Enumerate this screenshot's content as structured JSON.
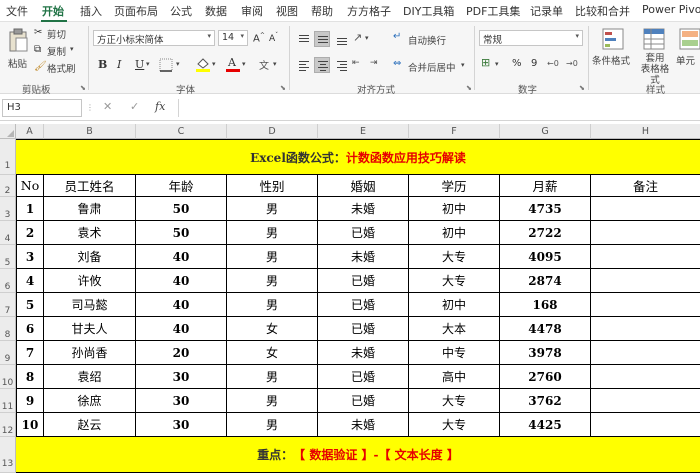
{
  "menu": {
    "items": [
      "文件",
      "开始",
      "插入",
      "页面布局",
      "公式",
      "数据",
      "审阅",
      "视图",
      "帮助",
      "方方格子",
      "DIY工具箱",
      "PDF工具集",
      "记录单",
      "比较和合并",
      "Power Pivot"
    ]
  },
  "ribbon": {
    "clipboard": {
      "paste": "粘贴",
      "cut": "剪切",
      "copy": "复制",
      "format_painter": "格式刷",
      "label": "剪贴板"
    },
    "font": {
      "family": "方正小标宋简体",
      "size": "14",
      "bold": "B",
      "italic": "I",
      "underline": "U",
      "label": "字体"
    },
    "alignment": {
      "wrap": "自动换行",
      "merge": "合并后居中",
      "label": "对齐方式"
    },
    "number": {
      "format": "常规",
      "percent": "%",
      "comma": "9",
      "label": "数字"
    },
    "styles": {
      "conditional": "条件格式",
      "table_format": "套用\n表格格式",
      "cell_styles": "单元",
      "label": "样式"
    }
  },
  "formula_bar": {
    "name_box": "H3",
    "cancel": "✕",
    "enter": "✓",
    "fx": "fx",
    "value": ""
  },
  "columns": [
    "A",
    "B",
    "C",
    "D",
    "E",
    "F",
    "G",
    "H"
  ],
  "rows": [
    "1",
    "2",
    "3",
    "4",
    "5",
    "6",
    "7",
    "8",
    "9",
    "10",
    "11",
    "12",
    "13"
  ],
  "sheet": {
    "title_prefix": "Excel函数公式：",
    "title_highlight": "计数函数应用技巧解读",
    "headers": [
      "No",
      "员工姓名",
      "年龄",
      "性别",
      "婚姻",
      "学历",
      "月薪",
      "备注"
    ],
    "records": [
      [
        "1",
        "鲁肃",
        "50",
        "男",
        "未婚",
        "初中",
        "4735",
        ""
      ],
      [
        "2",
        "袁术",
        "50",
        "男",
        "已婚",
        "初中",
        "2722",
        ""
      ],
      [
        "3",
        "刘备",
        "40",
        "男",
        "未婚",
        "大专",
        "4095",
        ""
      ],
      [
        "4",
        "许攸",
        "40",
        "男",
        "已婚",
        "大专",
        "2874",
        ""
      ],
      [
        "5",
        "司马懿",
        "40",
        "男",
        "已婚",
        "初中",
        "168",
        ""
      ],
      [
        "6",
        "甘夫人",
        "40",
        "女",
        "已婚",
        "大本",
        "4478",
        ""
      ],
      [
        "7",
        "孙尚香",
        "20",
        "女",
        "未婚",
        "中专",
        "3978",
        ""
      ],
      [
        "8",
        "袁绍",
        "30",
        "男",
        "已婚",
        "高中",
        "2760",
        ""
      ],
      [
        "9",
        "徐庶",
        "30",
        "男",
        "已婚",
        "大专",
        "3762",
        ""
      ],
      [
        "10",
        "赵云",
        "30",
        "男",
        "未婚",
        "大专",
        "4425",
        ""
      ]
    ],
    "footer_prefix": "重点：",
    "footer_highlight": "【 数据验证 】-【 文本长度 】"
  },
  "colors": {
    "banner_bg": "#ffff00",
    "highlight_text": "#e60000",
    "accent": "#217346"
  }
}
